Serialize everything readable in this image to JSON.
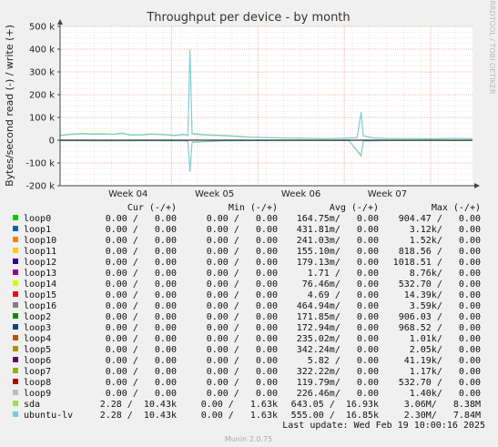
{
  "chart_data": {
    "type": "line",
    "title": "Throughput per device - by month",
    "ylabel": "Bytes/second read (-) / write (+)",
    "side_label": "RRDTOOL / TOBI OETIKER",
    "ylim": [
      -200000,
      500000
    ],
    "yticks": [
      {
        "value": 500000,
        "label": "500 k"
      },
      {
        "value": 400000,
        "label": "400 k"
      },
      {
        "value": 300000,
        "label": "300 k"
      },
      {
        "value": 200000,
        "label": "200 k"
      },
      {
        "value": 100000,
        "label": "100 k"
      },
      {
        "value": 0,
        "label": "0"
      },
      {
        "value": -100000,
        "label": "-100 k"
      },
      {
        "value": -200000,
        "label": "-200 k"
      }
    ],
    "xticks": [
      "Week 04",
      "Week 05",
      "Week 06",
      "Week 07"
    ],
    "grid": true,
    "series_visible": [
      {
        "name": "sda",
        "color": "#99e04f",
        "write": [
          [
            0,
            22000
          ],
          [
            0.02,
            26000
          ],
          [
            0.05,
            30000
          ],
          [
            0.08,
            28000
          ],
          [
            0.1,
            29000
          ],
          [
            0.13,
            27000
          ],
          [
            0.15,
            32000
          ],
          [
            0.17,
            24000
          ],
          [
            0.2,
            25000
          ],
          [
            0.22,
            28000
          ],
          [
            0.25,
            26000
          ],
          [
            0.28,
            22000
          ],
          [
            0.3,
            27000
          ],
          [
            0.31,
            22000
          ],
          [
            0.315,
            400000
          ],
          [
            0.32,
            30000
          ],
          [
            0.34,
            26000
          ],
          [
            0.37,
            23000
          ],
          [
            0.4,
            21000
          ],
          [
            0.43,
            18000
          ],
          [
            0.46,
            14000
          ],
          [
            0.5,
            12000
          ],
          [
            0.55,
            10000
          ],
          [
            0.6,
            9000
          ],
          [
            0.65,
            8000
          ],
          [
            0.68,
            9000
          ],
          [
            0.7,
            10000
          ],
          [
            0.72,
            12000
          ],
          [
            0.73,
            125000
          ],
          [
            0.735,
            20000
          ],
          [
            0.76,
            10000
          ],
          [
            0.8,
            8000
          ],
          [
            0.85,
            8000
          ],
          [
            0.9,
            7000
          ],
          [
            0.95,
            9000
          ],
          [
            1.0,
            8000
          ]
        ],
        "read": [
          [
            0,
            -2000
          ],
          [
            0.1,
            -3000
          ],
          [
            0.2,
            -2500
          ],
          [
            0.3,
            -3000
          ],
          [
            0.31,
            -5000
          ],
          [
            0.315,
            -140000
          ],
          [
            0.32,
            -10000
          ],
          [
            0.4,
            -3000
          ],
          [
            0.5,
            -2000
          ],
          [
            0.6,
            -1500
          ],
          [
            0.7,
            -2000
          ],
          [
            0.73,
            -70000
          ],
          [
            0.735,
            -4000
          ],
          [
            0.8,
            -1500
          ],
          [
            0.9,
            -1500
          ],
          [
            1.0,
            -1500
          ]
        ]
      },
      {
        "name": "ubuntu-lv",
        "color": "#7ac8e6",
        "write": [
          [
            0,
            20000
          ],
          [
            0.02,
            24000
          ],
          [
            0.05,
            28000
          ],
          [
            0.08,
            26000
          ],
          [
            0.1,
            27000
          ],
          [
            0.13,
            25000
          ],
          [
            0.15,
            30000
          ],
          [
            0.17,
            22000
          ],
          [
            0.2,
            23000
          ],
          [
            0.22,
            26000
          ],
          [
            0.25,
            24000
          ],
          [
            0.28,
            20000
          ],
          [
            0.3,
            25000
          ],
          [
            0.31,
            20000
          ],
          [
            0.315,
            390000
          ],
          [
            0.32,
            28000
          ],
          [
            0.34,
            24000
          ],
          [
            0.37,
            21000
          ],
          [
            0.4,
            19000
          ],
          [
            0.43,
            16000
          ],
          [
            0.46,
            13000
          ],
          [
            0.5,
            11000
          ],
          [
            0.55,
            9000
          ],
          [
            0.6,
            8000
          ],
          [
            0.65,
            7000
          ],
          [
            0.68,
            8000
          ],
          [
            0.7,
            9000
          ],
          [
            0.72,
            11000
          ],
          [
            0.73,
            120000
          ],
          [
            0.735,
            18000
          ],
          [
            0.76,
            9000
          ],
          [
            0.8,
            7000
          ],
          [
            0.85,
            7000
          ],
          [
            0.9,
            6000
          ],
          [
            0.95,
            8000
          ],
          [
            1.0,
            7000
          ]
        ],
        "read": [
          [
            0,
            -1500
          ],
          [
            0.1,
            -2500
          ],
          [
            0.2,
            -2000
          ],
          [
            0.3,
            -2500
          ],
          [
            0.31,
            -4000
          ],
          [
            0.315,
            -135000
          ],
          [
            0.32,
            -8000
          ],
          [
            0.4,
            -2500
          ],
          [
            0.5,
            -1500
          ],
          [
            0.6,
            -1200
          ],
          [
            0.7,
            -1500
          ],
          [
            0.73,
            -65000
          ],
          [
            0.735,
            -3500
          ],
          [
            0.8,
            -1200
          ],
          [
            0.9,
            -1200
          ],
          [
            1.0,
            -1200
          ]
        ]
      }
    ]
  },
  "table": {
    "headers": {
      "cur": "Cur (-/+)",
      "min": "Min (-/+)",
      "avg": "Avg (-/+)",
      "max": "Max (-/+)"
    },
    "rows": [
      {
        "name": "loop0",
        "color": "#00cc00",
        "cur": "0.00 /   0.00",
        "min": "0.00 /   0.00",
        "avg": "164.75m/   0.00",
        "max": "904.47 /   0.00"
      },
      {
        "name": "loop1",
        "color": "#0066b3",
        "cur": "0.00 /   0.00",
        "min": "0.00 /   0.00",
        "avg": "431.81m/   0.00",
        "max": "3.12k/   0.00"
      },
      {
        "name": "loop10",
        "color": "#ff8000",
        "cur": "0.00 /   0.00",
        "min": "0.00 /   0.00",
        "avg": "241.03m/   0.00",
        "max": "1.52k/   0.00"
      },
      {
        "name": "loop11",
        "color": "#ffcc00",
        "cur": "0.00 /   0.00",
        "min": "0.00 /   0.00",
        "avg": "155.10m/   0.00",
        "max": "818.56 /   0.00"
      },
      {
        "name": "loop12",
        "color": "#330099",
        "cur": "0.00 /   0.00",
        "min": "0.00 /   0.00",
        "avg": "179.13m/   0.00",
        "max": "1018.51 /   0.00"
      },
      {
        "name": "loop13",
        "color": "#990099",
        "cur": "0.00 /   0.00",
        "min": "0.00 /   0.00",
        "avg": "1.71 /   0.00",
        "max": "8.76k/   0.00"
      },
      {
        "name": "loop14",
        "color": "#ccff00",
        "cur": "0.00 /   0.00",
        "min": "0.00 /   0.00",
        "avg": "76.46m/   0.00",
        "max": "532.70 /   0.00"
      },
      {
        "name": "loop15",
        "color": "#ff0000",
        "cur": "0.00 /   0.00",
        "min": "0.00 /   0.00",
        "avg": "4.69 /   0.00",
        "max": "14.39k/   0.00"
      },
      {
        "name": "loop16",
        "color": "#808080",
        "cur": "0.00 /   0.00",
        "min": "0.00 /   0.00",
        "avg": "464.94m/   0.00",
        "max": "3.59k/   0.00"
      },
      {
        "name": "loop2",
        "color": "#008f00",
        "cur": "0.00 /   0.00",
        "min": "0.00 /   0.00",
        "avg": "171.85m/   0.00",
        "max": "906.03 /   0.00"
      },
      {
        "name": "loop3",
        "color": "#00487d",
        "cur": "0.00 /   0.00",
        "min": "0.00 /   0.00",
        "avg": "172.94m/   0.00",
        "max": "968.52 /   0.00"
      },
      {
        "name": "loop4",
        "color": "#b35a00",
        "cur": "0.00 /   0.00",
        "min": "0.00 /   0.00",
        "avg": "235.02m/   0.00",
        "max": "1.01k/   0.00"
      },
      {
        "name": "loop5",
        "color": "#b38f00",
        "cur": "0.00 /   0.00",
        "min": "0.00 /   0.00",
        "avg": "342.24m/   0.00",
        "max": "2.05k/   0.00"
      },
      {
        "name": "loop6",
        "color": "#6b006b",
        "cur": "0.00 /   0.00",
        "min": "0.00 /   0.00",
        "avg": "5.82 /   0.00",
        "max": "41.19k/   0.00"
      },
      {
        "name": "loop7",
        "color": "#8fb300",
        "cur": "0.00 /   0.00",
        "min": "0.00 /   0.00",
        "avg": "322.22m/   0.00",
        "max": "1.17k/   0.00"
      },
      {
        "name": "loop8",
        "color": "#b30000",
        "cur": "0.00 /   0.00",
        "min": "0.00 /   0.00",
        "avg": "119.79m/   0.00",
        "max": "532.70 /   0.00"
      },
      {
        "name": "loop9",
        "color": "#bebebe",
        "cur": "0.00 /   0.00",
        "min": "0.00 /   0.00",
        "avg": "226.46m/   0.00",
        "max": "1.40k/   0.00"
      },
      {
        "name": "sda",
        "color": "#99e04f",
        "cur": "2.28 /  10.43k",
        "min": "0.00 /   1.63k",
        "avg": "643.05 /  16.93k",
        "max": "3.06M/   8.38M"
      },
      {
        "name": "ubuntu-lv",
        "color": "#7ac8e6",
        "cur": "2.28 /  10.43k",
        "min": "0.00 /   1.63k",
        "avg": "555.00 /  16.85k",
        "max": "2.30M/   7.84M"
      }
    ]
  },
  "last_update": "Last update: Wed Feb 19 10:00:16 2025",
  "footer": "Munin 2.0.75"
}
